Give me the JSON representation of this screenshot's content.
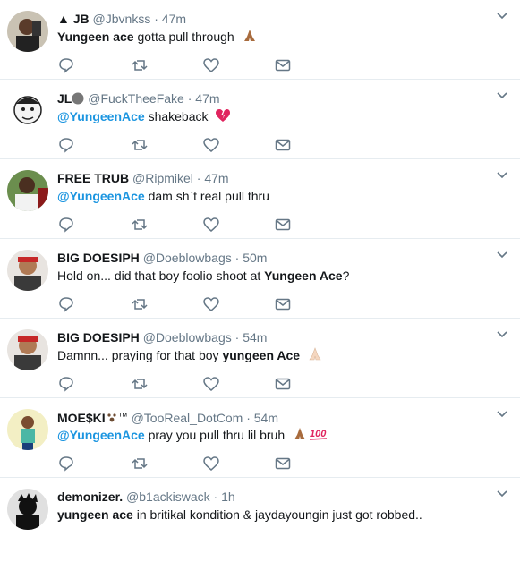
{
  "colors": {
    "link": "#1b95e0",
    "secondary": "#657786",
    "text": "#14171a",
    "divider": "#e6ecf0"
  },
  "icons": [
    "reply-icon",
    "retweet-icon",
    "like-icon",
    "dm-icon",
    "caret-down-icon"
  ],
  "tweets": [
    {
      "name": "▲ JB",
      "handle": "@Jbvnkss",
      "sep": "·",
      "time": "47m",
      "text_parts": [
        "Yungeen ace",
        " gotta pull through"
      ],
      "emoji": "folded-hands"
    },
    {
      "name": "JL",
      "handle": "@FuckTheeFake",
      "sep": "·",
      "time": "47m",
      "text_parts": [
        "@YungeenAce",
        " shakeback"
      ],
      "emoji": "broken-heart"
    },
    {
      "name": "FREE TRUB",
      "handle": "@Ripmikel",
      "sep": "·",
      "time": "47m",
      "text_parts": [
        "@YungeenAce",
        " dam sh`t real pull thru"
      ]
    },
    {
      "name": "BIG DOESIPH",
      "handle": "@Doeblowbags",
      "sep": "·",
      "time": "50m",
      "text_parts": [
        "Hold on... did that boy foolio shoot at ",
        "Yungeen Ace",
        "?"
      ]
    },
    {
      "name": "BIG DOESIPH",
      "handle": "@Doeblowbags",
      "sep": "·",
      "time": "54m",
      "text_parts": [
        "Damnn... praying for that boy ",
        "yungeen Ace"
      ],
      "emoji": "folded-hands-light"
    },
    {
      "name": "MOE$KI",
      "name_suffix": "™",
      "handle": "@TooReal_DotCom",
      "sep": "·",
      "time": "54m",
      "text_parts": [
        "@YungeenAce",
        " pray you pull thru lil bruh"
      ],
      "emoji": "folded-hands-100"
    },
    {
      "name": "demonizer.",
      "handle": "@b1ackiswack",
      "sep": "·",
      "time": "1h",
      "text_parts": [
        "yungeen ace",
        " in britikal kondition & jaydayoungin just got robbed.."
      ]
    }
  ]
}
